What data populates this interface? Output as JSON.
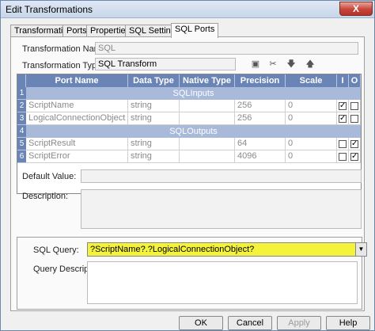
{
  "window": {
    "title": "Edit Transformations",
    "close_label": "X"
  },
  "tabs": [
    {
      "label": "Transformation"
    },
    {
      "label": "Ports"
    },
    {
      "label": "Properties"
    },
    {
      "label": "SQL Settings"
    },
    {
      "label": "SQL Ports",
      "active": true
    }
  ],
  "form": {
    "name_label": "Transformation Name:",
    "name_value": "SQL",
    "type_label": "Transformation Type:",
    "type_value": "SQL Transform"
  },
  "toolbar": {
    "new_icon": "new-port-icon",
    "cut_icon": "cut-icon",
    "down_icon": "move-down-icon",
    "up_icon": "move-up-icon"
  },
  "grid": {
    "columns": [
      "Port Name",
      "Data Type",
      "Native Type",
      "Precision",
      "Scale",
      "I",
      "O"
    ],
    "rows": [
      {
        "num": "1",
        "group": "SQLInputs"
      },
      {
        "num": "2",
        "port": "ScriptName",
        "datatype": "string",
        "native": "",
        "precision": "256",
        "scale": "0",
        "input": true,
        "output": false
      },
      {
        "num": "3",
        "port": "LogicalConnectionObject",
        "datatype": "string",
        "native": "",
        "precision": "256",
        "scale": "0",
        "input": true,
        "output": false
      },
      {
        "num": "4",
        "group": "SQLOutputs"
      },
      {
        "num": "5",
        "port": "ScriptResult",
        "datatype": "string",
        "native": "",
        "precision": "64",
        "scale": "0",
        "input": false,
        "output": true
      },
      {
        "num": "6",
        "port": "ScriptError",
        "datatype": "string",
        "native": "",
        "precision": "4096",
        "scale": "0",
        "input": false,
        "output": true
      }
    ]
  },
  "default_value_label": "Default Value:",
  "description_label": "Description:",
  "sql": {
    "query_label": "SQL Query:",
    "query_value": "?ScriptName?.?LogicalConnectionObject?",
    "query_description_label": "Query Description:"
  },
  "buttons": {
    "ok": "OK",
    "cancel": "Cancel",
    "apply": "Apply",
    "help": "Help"
  },
  "colors": {
    "grid_header": "#6a84b6",
    "group_row": "#a8b9da",
    "highlight": "#f4f23a"
  }
}
